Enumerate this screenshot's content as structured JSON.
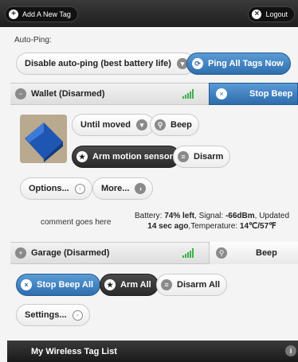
{
  "topbar": {
    "add_tag_label": "Add A New Tag",
    "logout_label": "Logout"
  },
  "autoping": {
    "label": "Auto-Ping:",
    "disable_label": "Disable auto-ping (best battery life)",
    "ping_all_label": "Ping All Tags Now"
  },
  "tags": [
    {
      "name": "Wallet (Disarmed)",
      "action_label": "Stop Beep",
      "until_moved_label": "Until moved",
      "beep_label": "Beep",
      "arm_motion_label": "Arm motion sensor",
      "disarm_label": "Disarm",
      "options_label": "Options...",
      "more_label": "More...",
      "comment": "comment goes here",
      "status": {
        "battery_prefix": "Battery: ",
        "battery_value": "74% left",
        "signal_prefix": ", Signal: ",
        "signal_value": "-66dBm",
        "updated_prefix": ", Updated",
        "updated_value": "14 sec ago",
        "temp_prefix": ",Temperature: ",
        "temp_value": "14℃/57℉"
      }
    },
    {
      "name": "Garage (Disarmed)",
      "action_label": "Beep"
    }
  ],
  "bulk": {
    "stop_beep_all_label": "Stop Beep All",
    "arm_all_label": "Arm All",
    "disarm_all_label": "Disarm All",
    "settings_label": "Settings..."
  },
  "footer": {
    "title": "My Wireless Tag List",
    "info_icon": "i"
  },
  "colors": {
    "accent_blue": "#2f6fae",
    "signal_green": "#3bb24a",
    "dark_bar": "#1e1e1e"
  }
}
